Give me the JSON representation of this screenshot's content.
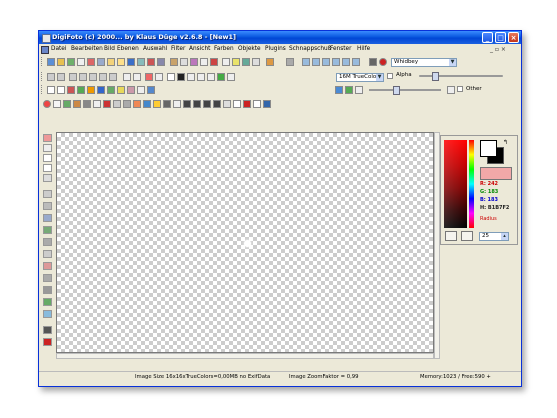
{
  "window": {
    "title": "DigiFoto (c) 2000... by Klaus Düge v2.6.8 - [New1]",
    "minimize": "_",
    "maximize": "□",
    "close": "×"
  },
  "menu": {
    "items": [
      "Datei",
      "Bearbeiten",
      "Bild",
      "Ebenen",
      "Auswahl",
      "Filter",
      "Ansicht",
      "Farben",
      "Objekte",
      "Plugins",
      "Schnappschuß",
      "Fenster",
      "Hilfe"
    ],
    "doc_controls": "_ ▫ ×"
  },
  "toolbar": {
    "font_select": "Whidbey",
    "color_mode_select": "16M TrueColor",
    "alpha_label": "Alpha",
    "other_label": "Other"
  },
  "palette": {
    "r_label": "R: 242",
    "g_label": "G: 183",
    "b_label": "B: 183",
    "hex_label": "H: B1B7F2",
    "radius_label": "Radius",
    "radius_value": "25",
    "swap_icon": "↰"
  },
  "status": {
    "image_size": "Image Size 16x16xTrueColors=0,00MB  no ExifData",
    "zoom": "Image ZoomFaktor = 0,99",
    "memory": "Memory:1023 / Free:590 +"
  },
  "colors": {
    "titlebar": "#0a58e0",
    "current_color": "#f2a8a8",
    "chrome": "#ece9d8"
  }
}
